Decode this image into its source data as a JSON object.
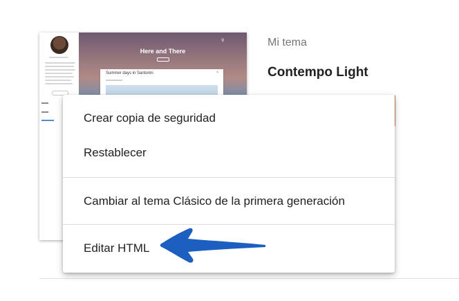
{
  "theme": {
    "section_label": "Mi tema",
    "name": "Contempo Light",
    "preview": {
      "hero_title": "Here and There",
      "post_title": "Summer days in Santorini"
    }
  },
  "menu": {
    "items": [
      {
        "label": "Crear copia de seguridad"
      },
      {
        "label": "Restablecer"
      },
      {
        "label": "Cambiar al tema Clásico de la primera generación"
      },
      {
        "label": "Editar HTML"
      }
    ]
  },
  "colors": {
    "arrow": "#1c5fc0",
    "menu_text": "#212121",
    "label_gray": "#757575"
  },
  "icons": [
    "search-icon",
    "share-icon",
    "arrow-pointer-icon"
  ]
}
